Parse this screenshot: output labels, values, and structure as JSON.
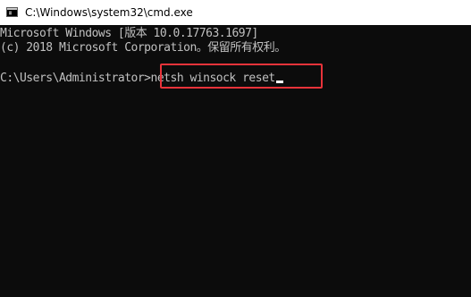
{
  "window": {
    "title": "C:\\Windows\\system32\\cmd.exe",
    "icon": "cmd-icon"
  },
  "console": {
    "banner_line1": "Microsoft Windows [版本 10.0.17763.1697]",
    "banner_line2": "(c) 2018 Microsoft Corporation。保留所有权利。",
    "prompt": "C:\\Users\\Administrator>",
    "command": "netsh winsock reset"
  },
  "colors": {
    "background": "#0c0c0c",
    "text": "#c0c0c0",
    "highlight_border": "#e8333a",
    "titlebar": "#ffffff"
  }
}
